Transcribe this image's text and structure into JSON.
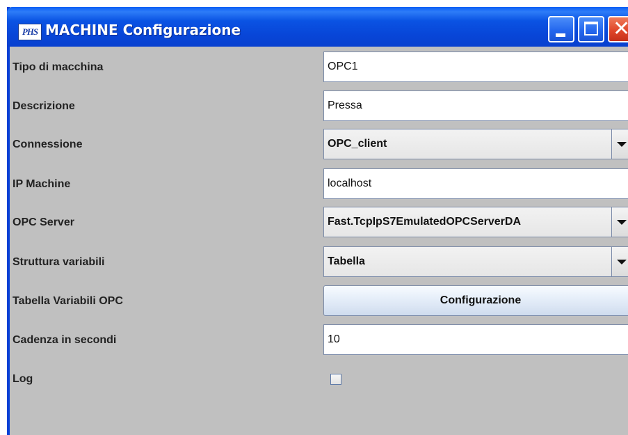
{
  "window": {
    "title": "MACHINE Configurazione",
    "icon_text": "PHS"
  },
  "form": {
    "tipo_label": "Tipo di macchina",
    "tipo_value": "OPC1",
    "descrizione_label": "Descrizione",
    "descrizione_value": "Pressa",
    "connessione_label": "Connessione",
    "connessione_value": "OPC_client",
    "ip_label": "IP Machine",
    "ip_value": "localhost",
    "opc_server_label": "OPC Server",
    "opc_server_value": "Fast.TcpIpS7EmulatedOPCServerDA",
    "struttura_label": "Struttura variabili",
    "struttura_value": "Tabella",
    "tabella_label": "Tabella Variabili OPC",
    "tabella_button": "Configurazione",
    "cadenza_label": "Cadenza in secondi",
    "cadenza_value": "10",
    "log_label": "Log",
    "log_checked": false
  },
  "colors": {
    "titlebar": "#0a53e3",
    "panel": "#c0c0c0",
    "close_button": "#e0472a"
  }
}
